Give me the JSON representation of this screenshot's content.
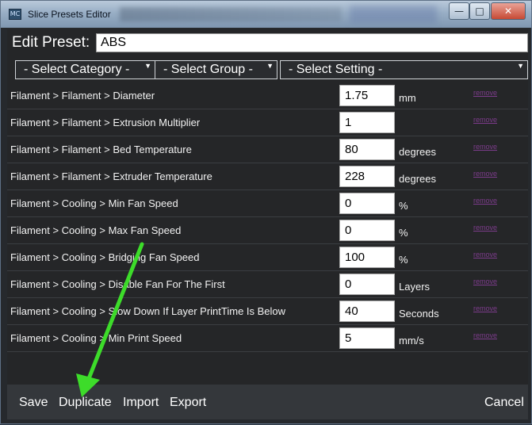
{
  "window": {
    "title": "Slice Presets Editor",
    "icon_name": "app-icon"
  },
  "edit": {
    "label": "Edit Preset:",
    "value": "ABS"
  },
  "selects": {
    "category": "- Select Category -",
    "group": "- Select Group -",
    "setting": "- Select Setting -"
  },
  "rows": [
    {
      "path": "Filament > Filament > Diameter",
      "value": "1.75",
      "unit": "mm",
      "remove": "remove"
    },
    {
      "path": "Filament > Filament > Extrusion Multiplier",
      "value": "1",
      "unit": "",
      "remove": "remove"
    },
    {
      "path": "Filament > Filament > Bed Temperature",
      "value": "80",
      "unit": "degrees",
      "remove": "remove"
    },
    {
      "path": "Filament > Filament > Extruder Temperature",
      "value": "228",
      "unit": "degrees",
      "remove": "remove"
    },
    {
      "path": "Filament > Cooling > Min Fan Speed",
      "value": "0",
      "unit": "%",
      "remove": "remove"
    },
    {
      "path": "Filament > Cooling > Max Fan Speed",
      "value": "0",
      "unit": "%",
      "remove": "remove"
    },
    {
      "path": "Filament > Cooling > Bridging Fan Speed",
      "value": "100",
      "unit": "%",
      "remove": "remove"
    },
    {
      "path": "Filament > Cooling > Disable Fan For The First",
      "value": "0",
      "unit": "Layers",
      "remove": "remove"
    },
    {
      "path": "Filament > Cooling > Slow Down If Layer PrintTime Is Below",
      "value": "40",
      "unit": "Seconds",
      "remove": "remove"
    },
    {
      "path": "Filament > Cooling > Min Print Speed",
      "value": "5",
      "unit": "mm/s",
      "remove": "remove"
    }
  ],
  "footer": {
    "save": "Save",
    "duplicate": "Duplicate",
    "import": "Import",
    "export": "Export",
    "cancel": "Cancel"
  },
  "colors": {
    "remove_link": "#7d3c8c",
    "annotation_arrow": "#3ddc2a"
  }
}
